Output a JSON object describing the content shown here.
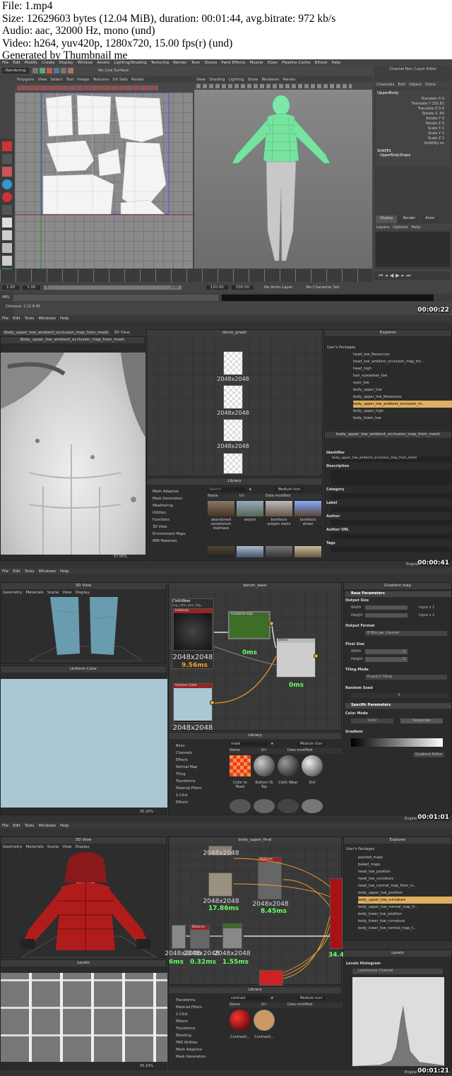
{
  "header": {
    "file": "File: 1.mp4",
    "size": "Size: 12629603 bytes (12.04 MiB), duration: 00:01:44, avg.bitrate: 972 kb/s",
    "audio": "Audio: aac, 32000 Hz, mono (und)",
    "video": "Video: h264, yuv420p, 1280x720, 15.00 fps(r) (und)",
    "generated": "Generated by Thumbnail me"
  },
  "f1": {
    "timestamp": "00:00:22",
    "menus": [
      "File",
      "Edit",
      "Modify",
      "Create",
      "Display",
      "Window",
      "Assets",
      "Lighting/Shading",
      "Texturing",
      "Render",
      "Toon",
      "Stereo",
      "Paint Effects",
      "Muscle",
      "XGen",
      "Pipeline Cache",
      "Bifrost",
      "Help"
    ],
    "mode": "Rendering",
    "live": "No Live Surface",
    "uv_menus": [
      "Polygons",
      "View",
      "Select",
      "Tool",
      "Image",
      "Textures",
      "UV Sets",
      "Panels"
    ],
    "vp_menus": [
      "View",
      "Shading",
      "Lighting",
      "Show",
      "Renderer",
      "Panels"
    ],
    "cb_title": "Channel Box / Layer Editor",
    "cb_menus": [
      "Channels",
      "Edit",
      "Object",
      "Show"
    ],
    "object": "UpperBody",
    "channels": [
      "Translate X 0",
      "Translate Y 155.82",
      "Translate Z 0.4",
      "Rotate X -90",
      "Rotate Y 0",
      "Rotate Z 0",
      "Scale X 1",
      "Scale Y 1",
      "Scale Z 1",
      "Visibility on"
    ],
    "shapes_title": "SHAPES",
    "shape": "UpperBodyShape",
    "tabs": [
      "Display",
      "Render",
      "Anim"
    ],
    "layer_menus": [
      "Layers",
      "Options",
      "Help"
    ],
    "range": [
      "1.00",
      "1.00",
      "1",
      "120",
      "120.00",
      "200.00"
    ],
    "anim_layer": "No Anim Layer",
    "char_set": "No Character Set",
    "mel": "MEL",
    "distance": "Distance: 2.22  6.46"
  },
  "f2": {
    "timestamp": "00:00:41",
    "menus": [
      "File",
      "Edit",
      "Tools",
      "Windows",
      "Help"
    ],
    "tab2d": "Body_upper_low_ambient_occlusion_map_from_mesh",
    "tab3d": "3D View",
    "panel2d": "Body_upper_low_ambient_occlusion_map_from_mesh",
    "zoom": "57.00%",
    "graph_title": "demo_graph",
    "node_label": "2048x2048",
    "explorer_title": "Explorer",
    "packages": "User's Packages",
    "tree": [
      "head_low_Resources",
      "head_low_ambient_occlusion_map_fro...",
      "head_high",
      "hair_eyelashes_low",
      "eyes_low",
      "body_upper_low",
      "body_upper_low_Resources",
      "body_upper_low_ambient_occlusion_m...",
      "body_upper_high",
      "body_lower_low"
    ],
    "props_title": "body_upper_low_ambient_occlusion_map_from_mesh",
    "fields": [
      "Identifier",
      "Description",
      "Category",
      "Label",
      "Author",
      "Author URL",
      "Tags"
    ],
    "identifier": "body_upper_low_ambient_occlusion_map_from_mesh",
    "library_title": "Library",
    "lib_cats": [
      "Mesh Adaptive",
      "Mask Generators",
      "Weathering",
      "Utilities",
      "Functions",
      "3D View",
      "Environment Maps",
      "PBR Materials"
    ],
    "search": "Search",
    "view": "Medium Icon",
    "cols": [
      "Name",
      "Url",
      "Date modified"
    ],
    "env": [
      "abandoned sanatorium staircase",
      "airport",
      "bonifacio aragon stairs",
      "bonifacio street"
    ],
    "engine": "Engine"
  },
  "f3": {
    "timestamp": "00:01:01",
    "menus": [
      "File",
      "Edit",
      "Tools",
      "Windows",
      "Help"
    ],
    "view3d": "3D View",
    "vmenus": [
      "Geometry",
      "Materials",
      "Scene",
      "View",
      "Display"
    ],
    "uniform": "Uniform Color",
    "zoom": "35.16%",
    "graph": "denim_wear",
    "frame_label": "ClothWear",
    "frame_sub": "avg_cloth_wear [ldg..",
    "n_instance": "Instance",
    "n_gradient": "Gradient map",
    "n_blend": "Blend",
    "n_uniform": "Uniform Color",
    "res": "2048x2048",
    "t1": "9.56ms",
    "t2": "0ms",
    "t3": "0ms",
    "props": "Gradient map",
    "base": "Base Parameters",
    "output_size": "Output Size",
    "width": "Width",
    "height": "Height",
    "input_x1": "Input x 1",
    "output_format": "Output Format",
    "format_val": "8 Bits per channel",
    "pixel_size": "Pixel Size",
    "one": "1",
    "tiling": "Tiling Mode",
    "tiling_val": "H and V Tiling",
    "random": "Random Seed",
    "zero": "0",
    "specific": "Specific Parameters",
    "color_mode": "Color Mode",
    "color_opt": "Color",
    "gray_opt": "Grayscale",
    "gradient": "Gradient",
    "editor": "Gradient Editor",
    "library": "Library",
    "cats": [
      "Blurs",
      "Channels",
      "Effects",
      "Normal Map",
      "Tiling",
      "Transforms",
      "Material Filters",
      "1-Click",
      "Effects"
    ],
    "search": "mask",
    "view": "Medium Icon",
    "cols": [
      "Name",
      "Url",
      "Date modified"
    ],
    "items": [
      "Color to Mask",
      "Bottom To Top",
      "Cloth Wear",
      "Dirt"
    ],
    "engine": "Engine"
  },
  "f4": {
    "timestamp": "00:01:21",
    "menus": [
      "File",
      "Edit",
      "Tools",
      "Windows",
      "Help"
    ],
    "view3d": "3D View",
    "vmenus": [
      "Geometry",
      "Materials",
      "Scene",
      "View",
      "Display"
    ],
    "graph": "body_upper_final",
    "res": "2048x2048",
    "t1": "17.86ms",
    "t2": "8.45ms",
    "t3": "6ms",
    "t4": "0.32ms",
    "t5": "1.55ms",
    "t6": "34.4",
    "n_balance": "Balance",
    "explorer": "Explorer",
    "packages": "User's Packages",
    "tree": [
      "painted_maps",
      "baked_maps",
      "head_low_position",
      "head_low_curvature",
      "head_low_normal_map_from_m...",
      "body_upper_low_position",
      "body_upper_low_curvature",
      "body_upper_low_normal_map_fr...",
      "body_lower_low_position",
      "body_lower_low_curvature",
      "body_lower_low_normal_map_f..."
    ],
    "levels_panel": "Levels",
    "zoom": "45.10%",
    "levels_props": "Levels",
    "hist": "Levels Histogram",
    "channel": "Luminance Channel",
    "library": "Library",
    "cats": [
      "Transforms",
      "Material Filters",
      "1-Click",
      "Effects",
      "Transforms",
      "Blending",
      "PBR Utilities",
      "Mesh Adaptive",
      "Mask Generators"
    ],
    "search": "contrast",
    "view": "Medium Icon",
    "cols": [
      "Name",
      "Url",
      "Date modified"
    ],
    "items": [
      "Contrast/...",
      "Contrast/..."
    ],
    "engine": "Engine"
  }
}
